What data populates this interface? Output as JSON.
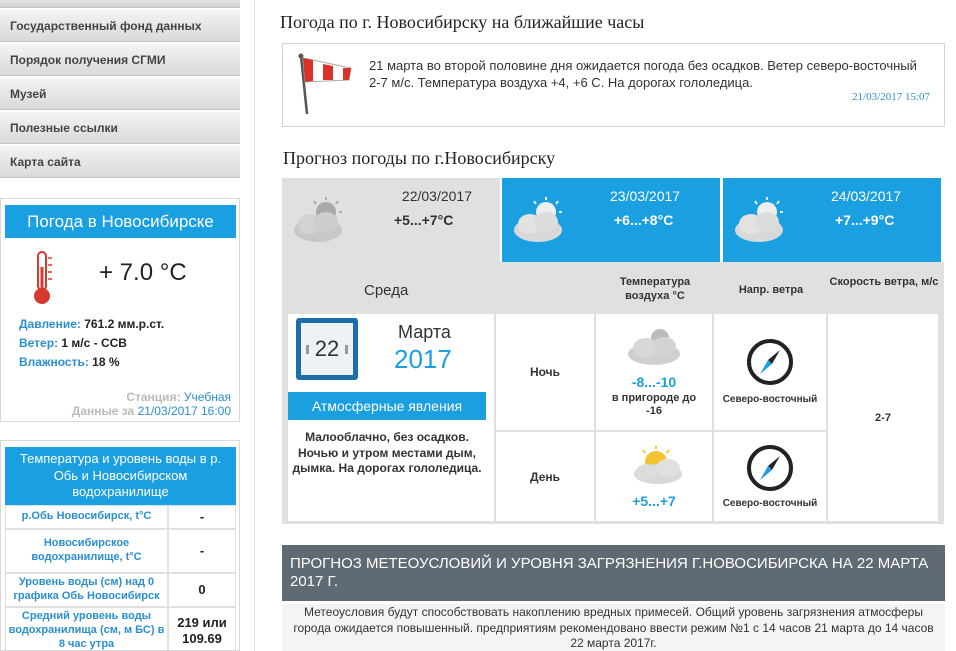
{
  "sidebar": {
    "menu": [
      "Государственный фонд данных",
      "Порядок получения СГМИ",
      "Музей",
      "Полезные ссылки",
      "Карта сайта"
    ],
    "weather": {
      "title": "Погода в Новосибирске",
      "temp": "+ 7.0 °С",
      "pressure_label": "Давление:",
      "pressure_value": "761.2 мм.р.ст.",
      "wind_label": "Ветер:",
      "wind_value": "1 м/с - ССВ",
      "humidity_label": "Влажность:",
      "humidity_value": "18 %",
      "station_label": "Станция:",
      "station_value": "Учебная",
      "data_label": "Данные за",
      "data_value": "21/03/2017 16:00"
    },
    "water": {
      "title": "Температура и уровень воды в р. Обь и Новосибирском водохранилище",
      "rows": [
        {
          "label": "р.Обь Новосибирск, t°С",
          "value": "-"
        },
        {
          "label": "Новосибирское водохранилище, t°С",
          "value": "-"
        },
        {
          "label": "Уровень воды (см) над 0 графика Обь Новосибирск",
          "value": "0"
        },
        {
          "label": "Средний уровень воды водохранилища (см, м БС) в 8 час утра",
          "value": "219 или 109.69"
        }
      ]
    }
  },
  "main": {
    "hourly_title": "Погода по г. Новосибирску на ближайшие часы",
    "alert_text": "21 марта во второй половине дня ожидается погода без осадков. Ветер северо-восточный 2-7 м/с. Температура воздуха +4, +6 С. На дорогах гололедица.",
    "alert_time": "21/03/2017 15:07",
    "forecast_title": "Прогноз погоды по г.Новосибирску",
    "days": [
      {
        "date": "22/03/2017",
        "temp": "+5...+7°C"
      },
      {
        "date": "23/03/2017",
        "temp": "+6...+8°C"
      },
      {
        "date": "24/03/2017",
        "temp": "+7...+9°C"
      }
    ],
    "detail": {
      "weekday": "Среда",
      "col_temp": "Температура воздуха °С",
      "col_dir": "Напр. ветра",
      "col_speed": "Скорость ветра, м/с",
      "day_num": "22",
      "month": "Марта",
      "year": "2017",
      "phen_button": "Атмосферные явления",
      "phen_text": "Малооблачно, без осадков. Ночью и утром местами дым, дымка. На дорогах гололедица.",
      "night_label": "Ночь",
      "night_temp": "-8...-10",
      "night_sub": "в пригороде до -16",
      "night_dir": "Северо-восточный",
      "day_label": "День",
      "day_temp": "+5...+7",
      "day_dir": "Северо-восточный",
      "speed": "2-7"
    },
    "pollution_title": "ПРОГНОЗ МЕТЕОУСЛОВИЙ И УРОВНЯ ЗАГРЯЗНЕНИЯ Г.НОВОСИБИРСКА НА 22 МАРТА 2017 Г.",
    "pollution_text": "Метеоусловия будут способствовать накоплению вредных примесей. Общий уровень загрязнения атмосферы города ожидается повышенный. предприятиям рекомендовано ввести режим №1 с 14 часов 21 марта до 14 часов 22 марта 2017г."
  }
}
